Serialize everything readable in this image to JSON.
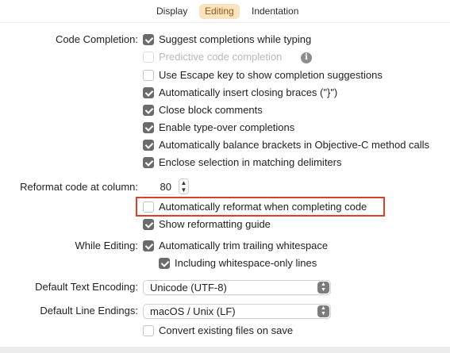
{
  "tabs": [
    {
      "label": "Display",
      "active": false
    },
    {
      "label": "Editing",
      "active": true
    },
    {
      "label": "Indentation",
      "active": false
    }
  ],
  "code_completion": {
    "label": "Code Completion:",
    "items": [
      {
        "label": "Suggest completions while typing",
        "checked": true,
        "disabled": false
      },
      {
        "label": "Predictive code completion",
        "checked": false,
        "disabled": true,
        "info": true
      },
      {
        "label": "Use Escape key to show completion suggestions",
        "checked": false,
        "disabled": false
      },
      {
        "label": "Automatically insert closing braces (\"}\")",
        "checked": true,
        "disabled": false
      },
      {
        "label": "Close block comments",
        "checked": true,
        "disabled": false
      },
      {
        "label": "Enable type-over completions",
        "checked": true,
        "disabled": false
      },
      {
        "label": "Automatically balance brackets in Objective-C method calls",
        "checked": true,
        "disabled": false
      },
      {
        "label": "Enclose selection in matching delimiters",
        "checked": true,
        "disabled": false
      }
    ]
  },
  "reformat": {
    "label": "Reformat code at column:",
    "column_value": "80",
    "items": [
      {
        "label": "Automatically reformat when completing code",
        "checked": false
      },
      {
        "label": "Show reformatting guide",
        "checked": true
      }
    ]
  },
  "while_editing": {
    "label": "While Editing:",
    "trim_label": "Automatically trim trailing whitespace",
    "trim_checked": true,
    "whitespace_only_label": "Including whitespace-only lines",
    "whitespace_only_checked": true
  },
  "text_encoding": {
    "label": "Default Text Encoding:",
    "value": "Unicode (UTF-8)"
  },
  "line_endings": {
    "label": "Default Line Endings:",
    "value": "macOS / Unix (LF)"
  },
  "convert_files": {
    "label": "Convert existing files on save",
    "checked": false
  },
  "colors": {
    "accent_tab_bg": "#fbe3bf",
    "highlight_border": "#d9412a",
    "checkbox_checked": "#6b6b6b"
  }
}
